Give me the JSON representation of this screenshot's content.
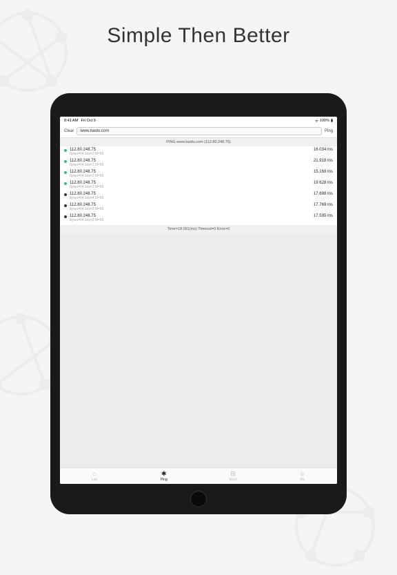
{
  "headline": "Simple Then Better",
  "statusBar": {
    "time": "8:41 AM",
    "date": "Fri Oct 9",
    "battery": "100%"
  },
  "toolbar": {
    "clear": "Clear",
    "urlValue": "www.baidu.com",
    "ping": "Ping"
  },
  "pingHeader": "PING www.baidu.com (112.80.248.75)",
  "results": [
    {
      "ip": "112.80.248.75",
      "sub": "bytes=64 seq=0 ttl=55",
      "time": "16.034 ms",
      "dot": "green"
    },
    {
      "ip": "112.80.248.75",
      "sub": "bytes=64 seq=1 ttl=55",
      "time": "21.918 ms",
      "dot": "green"
    },
    {
      "ip": "112.80.248.75",
      "sub": "bytes=64 seq=2 ttl=55",
      "time": "15.168 ms",
      "dot": "green"
    },
    {
      "ip": "112.80.248.75",
      "sub": "bytes=64 seq=3 ttl=55",
      "time": "19.628 ms",
      "dot": "green"
    },
    {
      "ip": "112.80.248.75",
      "sub": "bytes=64 seq=4 ttl=55",
      "time": "17.698 ms",
      "dot": "dark"
    },
    {
      "ip": "112.80.248.75",
      "sub": "bytes=64 seq=5 ttl=55",
      "time": "17.769 ms",
      "dot": "dark"
    },
    {
      "ip": "112.80.248.75",
      "sub": "bytes=64 seq=6 ttl=55",
      "time": "17.595 ms",
      "dot": "dark"
    }
  ],
  "summary": "Time=18.001(ms) Timeout=0 Error=0",
  "tabs": [
    {
      "label": "Lan",
      "icon": "⌂"
    },
    {
      "label": "Ping",
      "icon": "✱"
    },
    {
      "label": "More",
      "icon": "⊞"
    },
    {
      "label": "Me",
      "icon": "☺"
    }
  ]
}
